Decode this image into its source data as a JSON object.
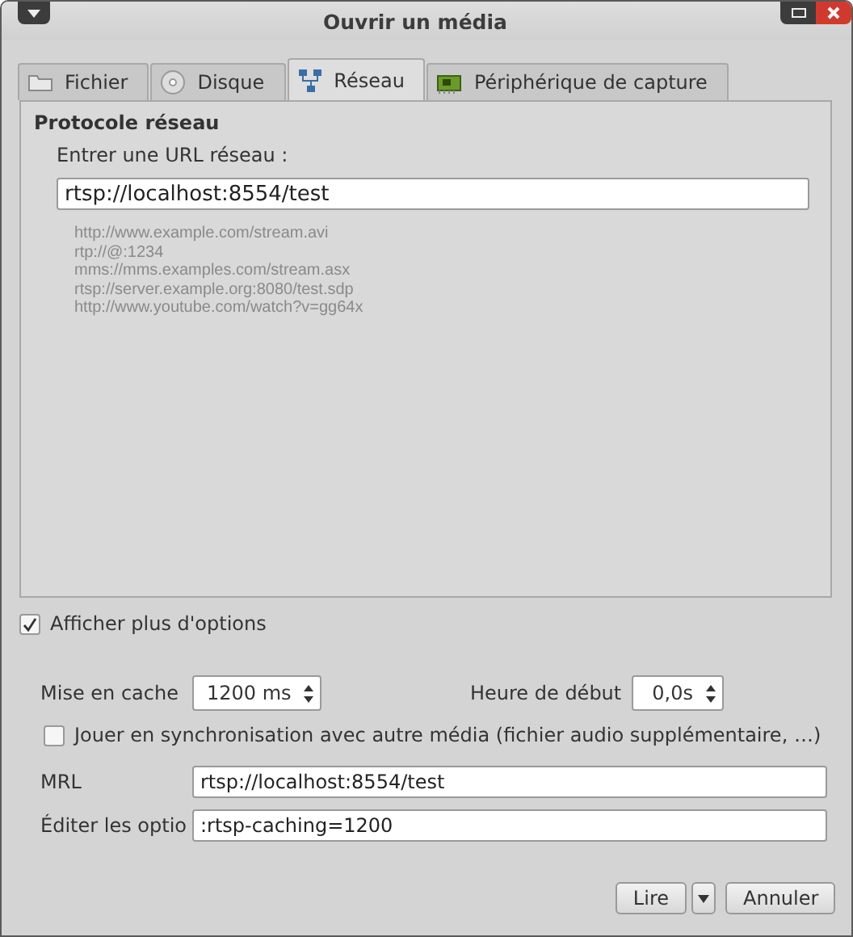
{
  "window": {
    "title": "Ouvrir un média"
  },
  "tabs": [
    {
      "label": "Fichier",
      "kind": "folder",
      "selected": false
    },
    {
      "label": "Disque",
      "kind": "disc",
      "selected": false
    },
    {
      "label": "Réseau",
      "kind": "network",
      "selected": true
    },
    {
      "label": "Périphérique de capture",
      "kind": "card",
      "selected": false
    }
  ],
  "network": {
    "heading": "Protocole réseau",
    "url_label": "Entrer une URL réseau :",
    "url_value": "rtsp://localhost:8554/test",
    "examples": [
      "http://www.example.com/stream.avi",
      "rtp://@:1234",
      "mms://mms.examples.com/stream.asx",
      "rtsp://server.example.org:8080/test.sdp",
      "http://www.youtube.com/watch?v=gg64x"
    ]
  },
  "more_options": {
    "label": "Afficher plus d'options",
    "checked": true
  },
  "caching": {
    "label": "Mise en cache",
    "value": "1200 ms"
  },
  "start_time": {
    "label": "Heure de début",
    "value": "0,0s"
  },
  "sync": {
    "label": "Jouer en synchronisation avec autre média (fichier audio supplémentaire, …)",
    "checked": false
  },
  "mrl": {
    "label": "MRL",
    "value": "rtsp://localhost:8554/test"
  },
  "edit_options": {
    "label": "Éditer les optio",
    "value": ":rtsp-caching=1200"
  },
  "buttons": {
    "play": "Lire",
    "cancel": "Annuler"
  }
}
